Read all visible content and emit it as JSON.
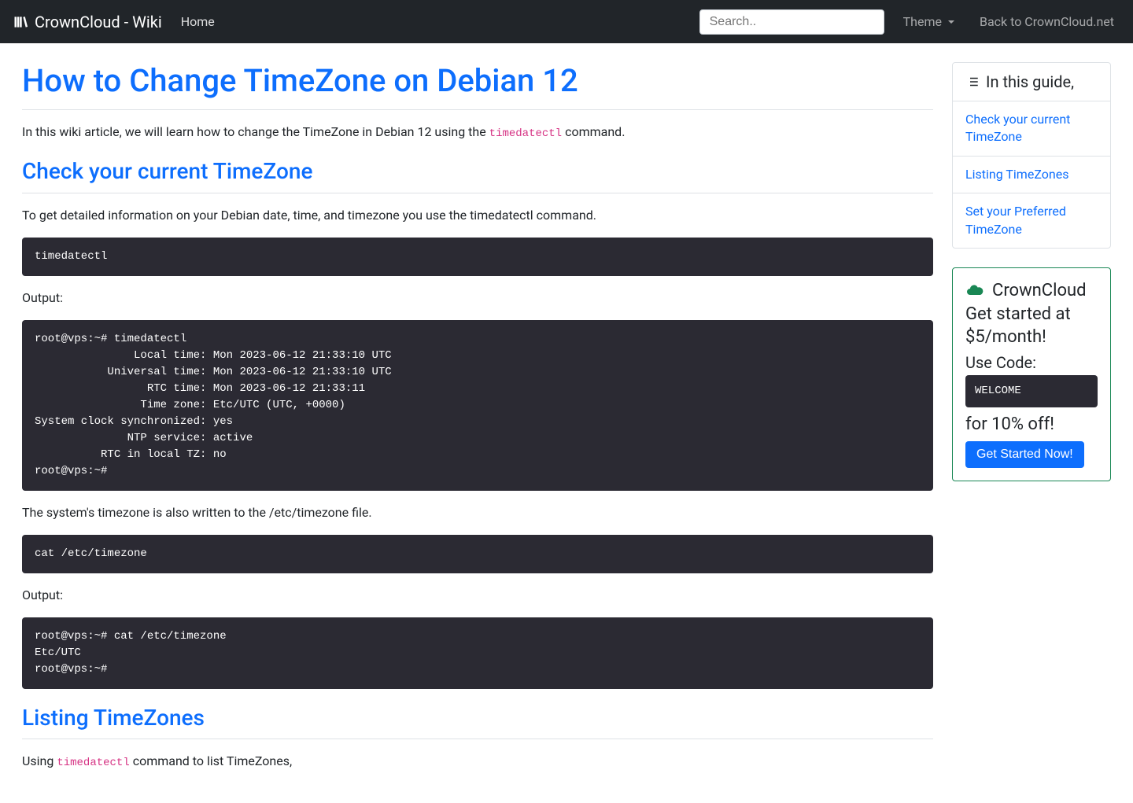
{
  "nav": {
    "brand": "CrownCloud - Wiki",
    "home": "Home",
    "search_placeholder": "Search..",
    "theme": "Theme",
    "back": "Back to CrownCloud.net"
  },
  "article": {
    "title": "How to Change TimeZone on Debian 12",
    "intro_pre": "In this wiki article, we will learn how to change the TimeZone in Debian 12 using the ",
    "intro_code": "timedatectl",
    "intro_post": " command.",
    "sec1_title": "Check your current TimeZone",
    "sec1_p": "To get detailed information on your Debian date, time, and timezone you use the timedatectl command.",
    "sec1_cmd": "timedatectl",
    "output_label": "Output:",
    "sec1_out": "root@vps:~# timedatectl\n               Local time: Mon 2023-06-12 21:33:10 UTC\n           Universal time: Mon 2023-06-12 21:33:10 UTC\n                 RTC time: Mon 2023-06-12 21:33:11\n                Time zone: Etc/UTC (UTC, +0000)\nSystem clock synchronized: yes\n              NTP service: active\n          RTC in local TZ: no\nroot@vps:~#",
    "sec1_p2": "The system's timezone is also written to the /etc/timezone file.",
    "sec1_cmd2": "cat /etc/timezone",
    "sec1_out2": "root@vps:~# cat /etc/timezone\nEtc/UTC\nroot@vps:~#",
    "sec2_title": "Listing TimeZones",
    "sec2_p_pre": "Using ",
    "sec2_p_code": "timedatectl",
    "sec2_p_post": " command to list TimeZones,"
  },
  "toc": {
    "header": "In this guide,",
    "items": [
      "Check your current TimeZone",
      "Listing TimeZones",
      "Set your Preferred TimeZone"
    ]
  },
  "promo": {
    "title": "CrownCloud",
    "sub": "Get started at $5/month!",
    "use_code": "Use Code:",
    "code": "WELCOME",
    "discount": "for 10% off!",
    "button": "Get Started Now!"
  }
}
